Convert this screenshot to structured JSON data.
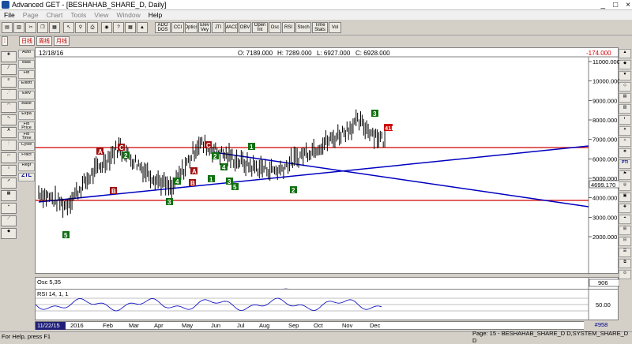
{
  "window": {
    "title": "Advanced GET - [BESHAHAB_SHARE_D, Daily]",
    "buttons": [
      "_",
      "□",
      "×"
    ]
  },
  "menu": [
    "File",
    "Page",
    "Chart",
    "Tools",
    "View",
    "Window",
    "Help"
  ],
  "toolbar": {
    "indicator_buttons": [
      "ADO DOS",
      "CCI",
      "Optics",
      "Elev Vey",
      "JTI",
      "MACD",
      "OBV",
      "Open Int",
      "Osc",
      "RSI",
      "Stoch",
      "Time Stats",
      "Vol"
    ]
  },
  "timeframes": [
    "日线",
    "周线",
    "月线"
  ],
  "left_tools": [
    "Auto",
    "Bias",
    "Fib",
    "Elliott",
    "Elev",
    "Base",
    "Expa",
    "Fib Price",
    "Fib Time",
    "Cycle",
    "Fract",
    "Regr",
    "ZTL"
  ],
  "chart": {
    "date": "12/18/16",
    "open": "O: 7189.000",
    "high": "H: 7289.000",
    "low": "L: 6927.000",
    "close": "C: 6928.000",
    "change": "-174.000",
    "price_ticks": [
      "11000.000",
      "10000.000",
      "9000.000",
      "8000.000",
      "7000.000",
      "6000.000",
      "5000.000",
      "4000.000",
      "3000.000",
      "2000.000"
    ],
    "current_price_label": "4699.170",
    "pti_label": "41PTI"
  },
  "osc": {
    "label": "Osc 5,35",
    "value": "906",
    "zero": "0"
  },
  "rsi": {
    "label": "RSI 14, 1, 1",
    "ref": "50.00"
  },
  "x_axis": {
    "start_date": "11/22/15",
    "labels": [
      "2016",
      "Feb",
      "Mar",
      "Apr",
      "May",
      "Jun",
      "Jul",
      "Aug",
      "Sep",
      "Oct",
      "Nov",
      "Dec"
    ],
    "bars_tag": "#958"
  },
  "status": {
    "left": "For Help, press F1",
    "right": "Page: 15 - BESHAHAB_SHARE_D D,SYSTEM_SHARE_D D"
  },
  "chart_data": {
    "type": "line",
    "title": "",
    "ylim": [
      1000,
      11500
    ],
    "x": [
      "11/22/15",
      "2016",
      "Feb",
      "Mar",
      "Apr",
      "May",
      "Jun",
      "Jul",
      "Aug",
      "Sep",
      "Oct",
      "Nov",
      "Dec"
    ],
    "series": [
      {
        "name": "",
        "values": [
          4300,
          3600,
          5200,
          6600,
          5400,
          4400,
          6800,
          6200,
          5600,
          5400,
          6300,
          7000,
          7900,
          6900
        ]
      }
    ]
  }
}
